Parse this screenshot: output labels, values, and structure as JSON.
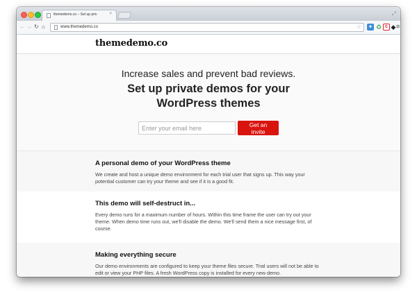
{
  "browser": {
    "tab_title": "themedemo.co – Set up priv",
    "tab_close": "×",
    "url": "www.themedemo.co",
    "nav": {
      "back": "←",
      "forward": "→",
      "reload": "↻",
      "home": "⌂"
    },
    "star": "☆",
    "menu": "≡",
    "extensions": [
      "puzzle-icon",
      "leaf-icon",
      "c-icon",
      "layers-icon"
    ]
  },
  "site": {
    "logo": "themedemo.co",
    "hero": {
      "tagline": "Increase sales and prevent bad reviews.",
      "headline": "Set up private demos for your WordPress themes",
      "email_placeholder": "Enter your email here",
      "cta": "Get an invite"
    },
    "features": [
      {
        "title": "A personal demo of your WordPress theme",
        "body": "We create and host a unique demo environment for each trial user that signs up. This way your potential customer can try your theme and see if it is a good fit."
      },
      {
        "title": "This demo will self-destruct in...",
        "body": "Every demo runs for a maximum number of hours. Within this time frame the user can try out your theme. When demo time runs out, we'll disable the demo. We'll send them a nice message first, of course."
      },
      {
        "title": "Making everything secure",
        "body": "Our demo environments are configured to keep your theme files secure. Trial users will not be able to edit or view your PHP files. A fresh WordPress copy is installed for every new demo."
      }
    ]
  },
  "colors": {
    "cta": "#d9140f",
    "tabbar": "#c9ced6"
  }
}
